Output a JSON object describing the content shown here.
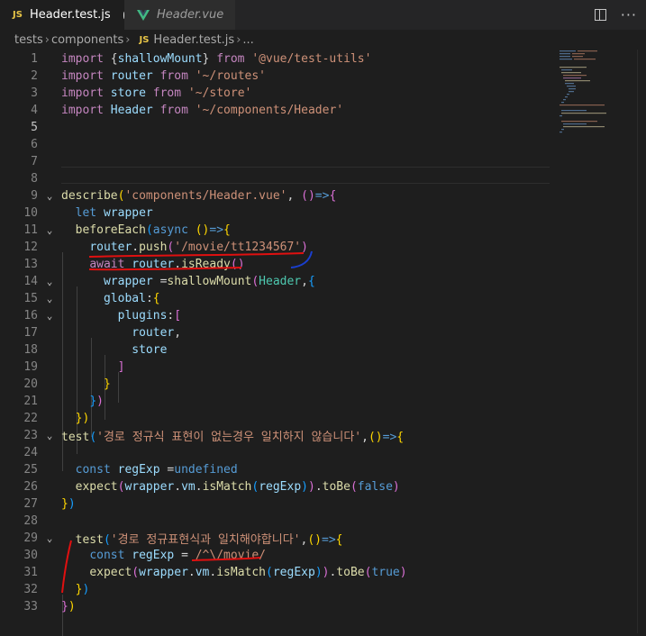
{
  "tabs": [
    {
      "label": "Header.test.js",
      "icon": "js-icon",
      "icon_text": "JS",
      "active": true,
      "dirty": true
    },
    {
      "label": "Header.vue",
      "icon": "vue-icon",
      "active": false
    }
  ],
  "breadcrumb": {
    "folder1": "tests",
    "folder2": "components",
    "file_icon_text": "JS",
    "file": "Header.test.js",
    "tail": "..."
  },
  "editor": {
    "current_line": 5,
    "lines": [
      {
        "n": 1,
        "fold": "",
        "tokens": [
          [
            "kw-import",
            "import"
          ],
          [
            "plain",
            " {"
          ],
          [
            "var",
            "shallowMount"
          ],
          [
            "plain",
            "} "
          ],
          [
            "kw-import",
            "from"
          ],
          [
            "plain",
            " "
          ],
          [
            "str",
            "'@vue/test-utils'"
          ]
        ]
      },
      {
        "n": 2,
        "fold": "",
        "tokens": [
          [
            "kw-import",
            "import"
          ],
          [
            "plain",
            " "
          ],
          [
            "var",
            "router"
          ],
          [
            "plain",
            " "
          ],
          [
            "kw-import",
            "from"
          ],
          [
            "plain",
            " "
          ],
          [
            "str",
            "'~/routes'"
          ]
        ]
      },
      {
        "n": 3,
        "fold": "",
        "tokens": [
          [
            "kw-import",
            "import"
          ],
          [
            "plain",
            " "
          ],
          [
            "var",
            "store"
          ],
          [
            "plain",
            " "
          ],
          [
            "kw-import",
            "from"
          ],
          [
            "plain",
            " "
          ],
          [
            "str",
            "'~/store'"
          ]
        ]
      },
      {
        "n": 4,
        "fold": "",
        "tokens": [
          [
            "kw-import",
            "import"
          ],
          [
            "plain",
            " "
          ],
          [
            "var",
            "Header"
          ],
          [
            "plain",
            " "
          ],
          [
            "kw-import",
            "from"
          ],
          [
            "plain",
            " "
          ],
          [
            "str",
            "'~/components/Header'"
          ]
        ]
      },
      {
        "n": 5,
        "fold": "",
        "tokens": []
      },
      {
        "n": 6,
        "fold": "",
        "tokens": []
      },
      {
        "n": 7,
        "fold": "",
        "tokens": []
      },
      {
        "n": 8,
        "fold": "",
        "tokens": []
      },
      {
        "n": 9,
        "fold": "v",
        "tokens": [
          [
            "fn",
            "describe"
          ],
          [
            "brk1",
            "("
          ],
          [
            "str",
            "'components/Header.vue'"
          ],
          [
            "plain",
            ", "
          ],
          [
            "brk2",
            "()"
          ],
          [
            "kw",
            "=>"
          ],
          [
            "brk2",
            "{"
          ]
        ]
      },
      {
        "n": 10,
        "fold": "",
        "tokens": [
          [
            "plain",
            "  "
          ],
          [
            "kw",
            "let"
          ],
          [
            "plain",
            " "
          ],
          [
            "var",
            "wrapper"
          ]
        ]
      },
      {
        "n": 11,
        "fold": "v",
        "tokens": [
          [
            "plain",
            "  "
          ],
          [
            "fn",
            "beforeEach"
          ],
          [
            "brk3",
            "("
          ],
          [
            "kw",
            "async"
          ],
          [
            "plain",
            " "
          ],
          [
            "brk1",
            "()"
          ],
          [
            "kw",
            "=>"
          ],
          [
            "brk1",
            "{"
          ]
        ]
      },
      {
        "n": 12,
        "fold": "",
        "tokens": [
          [
            "plain",
            "    "
          ],
          [
            "var",
            "router"
          ],
          [
            "plain",
            "."
          ],
          [
            "fn",
            "push"
          ],
          [
            "brk2",
            "("
          ],
          [
            "str",
            "'/movie/tt1234567'"
          ],
          [
            "brk2",
            ")"
          ]
        ]
      },
      {
        "n": 13,
        "fold": "",
        "tokens": [
          [
            "plain",
            "    "
          ],
          [
            "ctl",
            "await"
          ],
          [
            "plain",
            " "
          ],
          [
            "var",
            "router"
          ],
          [
            "plain",
            "."
          ],
          [
            "fn",
            "isReady"
          ],
          [
            "brk2",
            "()"
          ]
        ]
      },
      {
        "n": 14,
        "fold": "v",
        "tokens": [
          [
            "plain",
            "      "
          ],
          [
            "var",
            "wrapper"
          ],
          [
            "plain",
            " ="
          ],
          [
            "fn",
            "shallowMount"
          ],
          [
            "brk2",
            "("
          ],
          [
            "cls",
            "Header"
          ],
          [
            "plain",
            ","
          ],
          [
            "brk3",
            "{"
          ]
        ]
      },
      {
        "n": 15,
        "fold": "v",
        "tokens": [
          [
            "plain",
            "      "
          ],
          [
            "var",
            "global"
          ],
          [
            "plain",
            ":"
          ],
          [
            "brk1",
            "{"
          ]
        ]
      },
      {
        "n": 16,
        "fold": "v",
        "tokens": [
          [
            "plain",
            "        "
          ],
          [
            "var",
            "plugins"
          ],
          [
            "plain",
            ":"
          ],
          [
            "brk2",
            "["
          ]
        ]
      },
      {
        "n": 17,
        "fold": "",
        "tokens": [
          [
            "plain",
            "          "
          ],
          [
            "var",
            "router"
          ],
          [
            "plain",
            ","
          ]
        ]
      },
      {
        "n": 18,
        "fold": "",
        "tokens": [
          [
            "plain",
            "          "
          ],
          [
            "var",
            "store"
          ]
        ]
      },
      {
        "n": 19,
        "fold": "",
        "tokens": [
          [
            "plain",
            "        "
          ],
          [
            "brk2",
            "]"
          ]
        ]
      },
      {
        "n": 20,
        "fold": "",
        "tokens": [
          [
            "plain",
            "      "
          ],
          [
            "brk1",
            "}"
          ]
        ]
      },
      {
        "n": 21,
        "fold": "",
        "tokens": [
          [
            "plain",
            "    "
          ],
          [
            "brk3",
            "}"
          ],
          [
            "brk2",
            ")"
          ]
        ]
      },
      {
        "n": 22,
        "fold": "",
        "tokens": [
          [
            "plain",
            "  "
          ],
          [
            "brk1",
            "})"
          ]
        ]
      },
      {
        "n": 23,
        "fold": "v",
        "tokens": [
          [
            "fn",
            "test"
          ],
          [
            "brk3",
            "("
          ],
          [
            "str",
            "'경로 정규식 표현이 없는경우 일치하지 않습니다'"
          ],
          [
            "plain",
            ","
          ],
          [
            "brk1",
            "()"
          ],
          [
            "kw",
            "=>"
          ],
          [
            "brk1",
            "{"
          ]
        ]
      },
      {
        "n": 24,
        "fold": "",
        "tokens": []
      },
      {
        "n": 25,
        "fold": "",
        "tokens": [
          [
            "plain",
            "  "
          ],
          [
            "kw",
            "const"
          ],
          [
            "plain",
            " "
          ],
          [
            "var",
            "regExp"
          ],
          [
            "plain",
            " ="
          ],
          [
            "kw",
            "undefined"
          ]
        ]
      },
      {
        "n": 26,
        "fold": "",
        "tokens": [
          [
            "plain",
            "  "
          ],
          [
            "fn",
            "expect"
          ],
          [
            "brk2",
            "("
          ],
          [
            "var",
            "wrapper"
          ],
          [
            "plain",
            "."
          ],
          [
            "var",
            "vm"
          ],
          [
            "plain",
            "."
          ],
          [
            "fn",
            "isMatch"
          ],
          [
            "brk3",
            "("
          ],
          [
            "var",
            "regExp"
          ],
          [
            "brk3",
            ")"
          ],
          [
            "brk2",
            ")"
          ],
          [
            "plain",
            "."
          ],
          [
            "fn",
            "toBe"
          ],
          [
            "brk2",
            "("
          ],
          [
            "kw",
            "false"
          ],
          [
            "brk2",
            ")"
          ]
        ]
      },
      {
        "n": 27,
        "fold": "",
        "tokens": [
          [
            "brk1",
            "}"
          ],
          [
            "brk3",
            ")"
          ]
        ]
      },
      {
        "n": 28,
        "fold": "",
        "tokens": []
      },
      {
        "n": 29,
        "fold": "v",
        "tokens": [
          [
            "plain",
            "  "
          ],
          [
            "fn",
            "test"
          ],
          [
            "brk3",
            "("
          ],
          [
            "str",
            "'경로 정규표현식과 일치해야합니다'"
          ],
          [
            "plain",
            ","
          ],
          [
            "brk1",
            "()"
          ],
          [
            "kw",
            "=>"
          ],
          [
            "brk1",
            "{"
          ]
        ]
      },
      {
        "n": 30,
        "fold": "",
        "tokens": [
          [
            "plain",
            "    "
          ],
          [
            "kw",
            "const"
          ],
          [
            "plain",
            " "
          ],
          [
            "var",
            "regExp"
          ],
          [
            "plain",
            " = "
          ],
          [
            "str",
            "/^\\/movie/"
          ]
        ]
      },
      {
        "n": 31,
        "fold": "",
        "tokens": [
          [
            "plain",
            "    "
          ],
          [
            "fn",
            "expect"
          ],
          [
            "brk2",
            "("
          ],
          [
            "var",
            "wrapper"
          ],
          [
            "plain",
            "."
          ],
          [
            "var",
            "vm"
          ],
          [
            "plain",
            "."
          ],
          [
            "fn",
            "isMatch"
          ],
          [
            "brk3",
            "("
          ],
          [
            "var",
            "regExp"
          ],
          [
            "brk3",
            ")"
          ],
          [
            "brk2",
            ")"
          ],
          [
            "plain",
            "."
          ],
          [
            "fn",
            "toBe"
          ],
          [
            "brk2",
            "("
          ],
          [
            "kw",
            "true"
          ],
          [
            "brk2",
            ")"
          ]
        ]
      },
      {
        "n": 32,
        "fold": "",
        "tokens": [
          [
            "plain",
            "  "
          ],
          [
            "brk1",
            "}"
          ],
          [
            "brk3",
            ")"
          ]
        ]
      },
      {
        "n": 33,
        "fold": "",
        "tokens": [
          [
            "brk2",
            "}"
          ],
          [
            "brk1",
            ")"
          ]
        ]
      }
    ]
  },
  "colors": {
    "background": "#1e1e1e",
    "annotation_red": "#e01010",
    "annotation_blue": "#1a3fd0"
  }
}
